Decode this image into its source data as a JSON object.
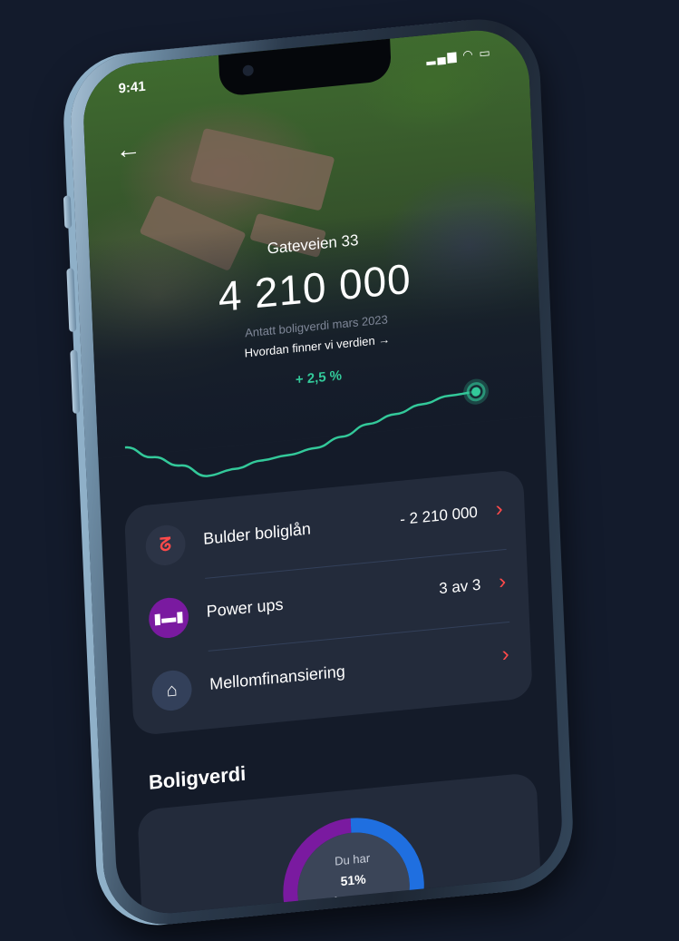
{
  "status": {
    "time": "9:41",
    "icons": "signal-wifi-battery"
  },
  "property": {
    "address": "Gateveien 33",
    "value": "4 210 000",
    "caption": "Antatt boligverdi mars 2023",
    "how_link": "Hvordan finner vi verdien →",
    "change": "+ 2,5 %"
  },
  "chart_data": {
    "type": "line",
    "series": [
      {
        "values": [
          0.62,
          0.45,
          0.3,
          0.12,
          0.18,
          0.26,
          0.3,
          0.36,
          0.48,
          0.62,
          0.72,
          0.82,
          0.9,
          0.92
        ]
      }
    ],
    "accent": "#33c99a"
  },
  "items": [
    {
      "label": "Bulder boliglån",
      "value": "- 2 210 000",
      "icon": "bulder-logo-icon",
      "icon_color": "#ff4a4a"
    },
    {
      "label": "Power ups",
      "value": "3 av 3",
      "icon": "dumbbell-icon",
      "icon_color": "#7a1aa0"
    },
    {
      "label": "Mellomfinansiering",
      "value": "",
      "icon": "house-icon",
      "icon_color": "#33405a"
    }
  ],
  "section": {
    "title": "Boligverdi"
  },
  "donut": {
    "line1": "Du har",
    "percent": "51%",
    "line3": "belåningsgrad",
    "fraction": 0.51,
    "colors": {
      "primary": "#1f6fe0",
      "secondary": "#7a1aa0"
    }
  },
  "colors": {
    "background": "#131b2c",
    "screen": "#141b29",
    "card": "#232b3b",
    "chevron": "#ff4a4a"
  }
}
